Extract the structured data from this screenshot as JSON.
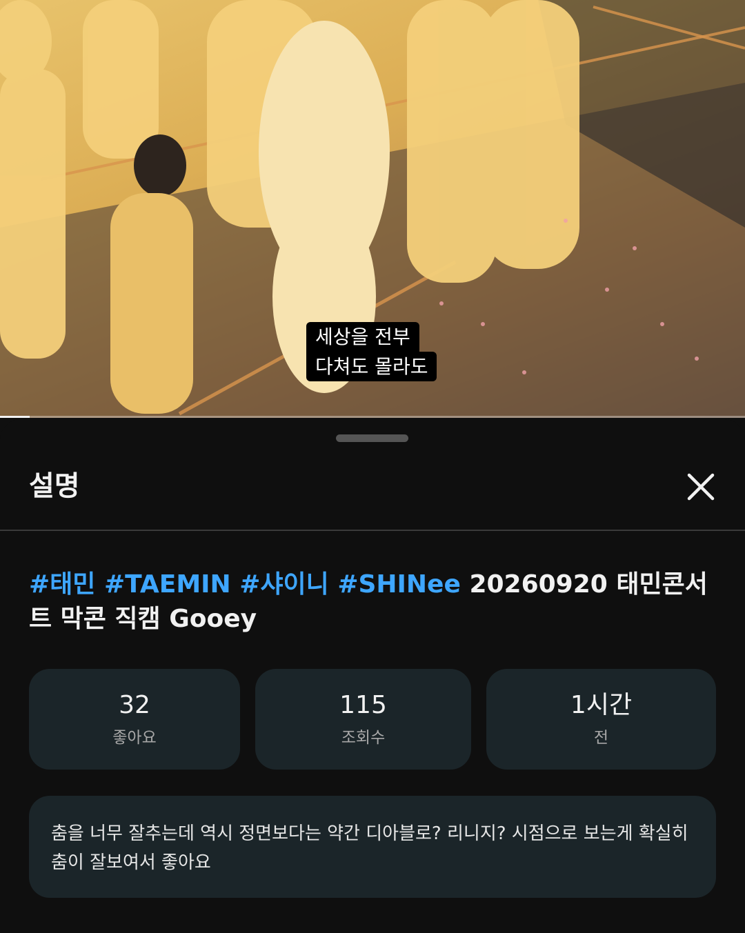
{
  "video": {
    "caption_line1": "세상을 전부",
    "caption_line2": "다쳐도 몰라도",
    "progress_fraction": 0.04
  },
  "sheet": {
    "title": "설명",
    "close_icon": "close-icon"
  },
  "video_title": {
    "hashtags": [
      "#태민",
      "#TAEMIN",
      "#샤이니",
      "#SHINee"
    ],
    "text": "20260920 태민콘서트 막콘 직캠 Gooey"
  },
  "stats": {
    "likes": {
      "value": "32",
      "label": "좋아요"
    },
    "views": {
      "value": "115",
      "label": "조회수"
    },
    "age": {
      "value": "1시간",
      "label": "전"
    }
  },
  "description": {
    "text": "춤을 너무 잘추는데 역시 정면보다는 약간 디아블로? 리니지? 시점으로 보는게 확실히 춤이 잘보여서 좋아요"
  },
  "colors": {
    "background": "#0f0f0f",
    "card": "#1b2529",
    "hashtag": "#3ea6ff",
    "text": "#f1f1f1",
    "subtext": "#a8a8a8"
  }
}
